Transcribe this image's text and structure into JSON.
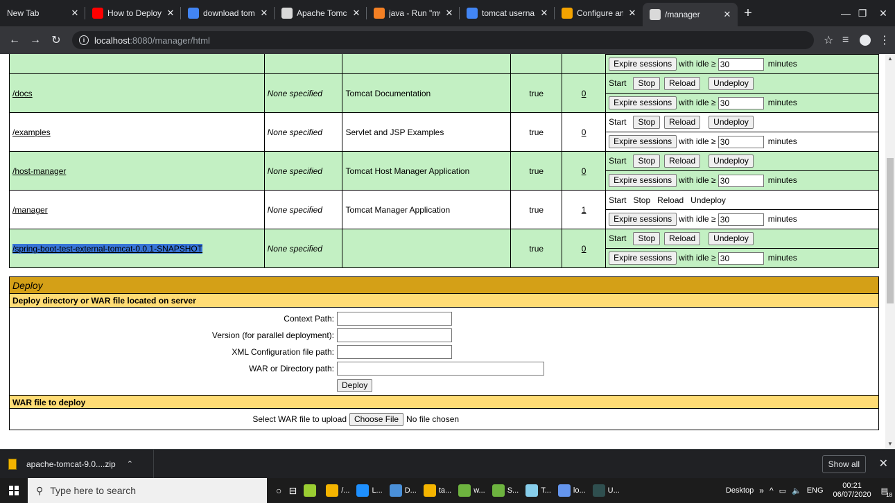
{
  "browser": {
    "tabs": [
      {
        "title": "New Tab",
        "icon": "none",
        "color": ""
      },
      {
        "title": "How to Deploy",
        "icon": "youtube-icon",
        "color": "#ff0000"
      },
      {
        "title": "download tom",
        "icon": "google-icon",
        "color": "#4285f4"
      },
      {
        "title": "Apache Tomca",
        "icon": "tomcat-icon",
        "color": "#d9d9d9"
      },
      {
        "title": "java - Run \"mv",
        "icon": "stackoverflow-icon",
        "color": "#f48024"
      },
      {
        "title": "tomcat userna",
        "icon": "google-icon",
        "color": "#4285f4"
      },
      {
        "title": "Configure and",
        "icon": "configure-icon",
        "color": "#f4a300"
      },
      {
        "title": "/manager",
        "icon": "tomcat-icon",
        "color": "#d9d9d9",
        "active": true
      }
    ],
    "url_host": "localhost",
    "url_path": ":8080/manager/html"
  },
  "apps": {
    "rows": [
      {
        "path": "",
        "version": "",
        "display_name": "",
        "running": "",
        "sessions": "",
        "commands_style": "none",
        "partial": true
      },
      {
        "path": "/docs",
        "version": "None specified",
        "display_name": "Tomcat Documentation",
        "running": "true",
        "sessions": "0",
        "commands_style": "buttons"
      },
      {
        "path": "/examples",
        "version": "None specified",
        "display_name": "Servlet and JSP Examples",
        "running": "true",
        "sessions": "0",
        "commands_style": "buttons"
      },
      {
        "path": "/host-manager",
        "version": "None specified",
        "display_name": "Tomcat Host Manager Application",
        "running": "true",
        "sessions": "0",
        "commands_style": "buttons"
      },
      {
        "path": "/manager",
        "version": "None specified",
        "display_name": "Tomcat Manager Application",
        "running": "true",
        "sessions": "1",
        "commands_style": "plain"
      },
      {
        "path": "/spring-boot-test-external-tomcat-0.0.1-SNAPSHOT",
        "version": "None specified",
        "display_name": "",
        "running": "true",
        "sessions": "0",
        "commands_style": "buttons",
        "selected": true
      }
    ],
    "commands": {
      "start": "Start",
      "stop": "Stop",
      "reload": "Reload",
      "undeploy": "Undeploy"
    },
    "expire": {
      "button": "Expire sessions",
      "with_idle": "with idle ≥",
      "idle_value": "30",
      "minutes": "minutes"
    }
  },
  "deploy": {
    "title": "Deploy",
    "server_section": "Deploy directory or WAR file located on server",
    "context_path_label": "Context Path:",
    "version_label": "Version (for parallel deployment):",
    "xml_config_label": "XML Configuration file path:",
    "war_dir_label": "WAR or Directory path:",
    "deploy_button": "Deploy",
    "war_section": "WAR file to deploy",
    "select_war_label": "Select WAR file to upload",
    "choose_file_button": "Choose File",
    "no_file": "No file chosen"
  },
  "downloads": {
    "file_name": "apache-tomcat-9.0....zip",
    "show_all": "Show all"
  },
  "taskbar": {
    "search_placeholder": "Type here to search",
    "apps": [
      {
        "label": "",
        "color": "#9acd32"
      },
      {
        "label": "/...",
        "color": "#f4b400"
      },
      {
        "label": "L...",
        "color": "#1e90ff"
      },
      {
        "label": "D...",
        "color": "#4a90d9"
      },
      {
        "label": "ta...",
        "color": "#f4b400"
      },
      {
        "label": "w...",
        "color": "#6db33f"
      },
      {
        "label": "S...",
        "color": "#6db33f"
      },
      {
        "label": "T...",
        "color": "#87ceeb"
      },
      {
        "label": "lo...",
        "color": "#6495ed"
      },
      {
        "label": "U...",
        "color": "#2f4f4f"
      }
    ],
    "desktop_label": "Desktop",
    "language": "ENG",
    "time": "00:21",
    "date": "06/07/2020",
    "notification_count": "18"
  }
}
